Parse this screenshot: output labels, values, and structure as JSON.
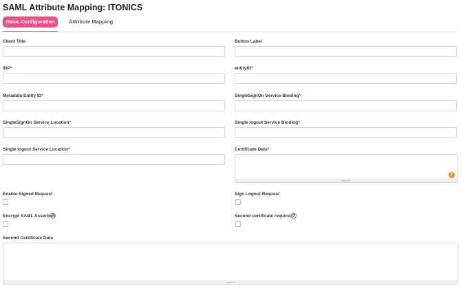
{
  "page": {
    "title": "SAML Attribute Mapping: ITONICS"
  },
  "tabs": [
    {
      "label": "Basic Configuration",
      "active": true
    },
    {
      "label": "Attribute Mapping",
      "active": false
    }
  ],
  "fields": {
    "client_title": {
      "label": "Client Title",
      "value": ""
    },
    "button_label": {
      "label": "Button Label",
      "value": ""
    },
    "idp": {
      "label": "IDP",
      "required_mark": "*",
      "value": ""
    },
    "entity_id": {
      "label": "entityID",
      "required_mark": "*",
      "value": ""
    },
    "metadata_entity_id": {
      "label": "Metadata Entity ID",
      "required_mark": "*",
      "value": ""
    },
    "sso_service_binding": {
      "label": "SingleSignOn Service Binding",
      "required_mark": "*",
      "value": ""
    },
    "sso_service_location": {
      "label": "SingleSignOn Service Location",
      "required_mark": "*",
      "value": ""
    },
    "slo_service_binding": {
      "label": "Single logout Service Binding",
      "required_mark": "*",
      "value": ""
    },
    "slo_service_location": {
      "label": "Single logout Service Location",
      "required_mark": "*",
      "value": ""
    },
    "certificate_data": {
      "label": "Certificate Data",
      "required_mark": "*",
      "value": "",
      "help_badge": "?"
    },
    "second_certificate_data": {
      "label": "Second Certificate Data",
      "value": ""
    }
  },
  "checkboxes": {
    "enable_signed_request": {
      "label": "Enable Signed Request",
      "checked": false
    },
    "sign_logout_request": {
      "label": "Sign Logout Request",
      "checked": false
    },
    "encrypt_saml_assertion": {
      "label": "Encrypt SAML Assertion",
      "checked": false,
      "info": "?"
    },
    "second_certificate_required": {
      "label": "Second certificate required?",
      "checked": false,
      "info": "?"
    }
  },
  "colors": {
    "accent": "#ee4f8b",
    "required": "#d9262b",
    "help_badge": "#f08a24"
  }
}
